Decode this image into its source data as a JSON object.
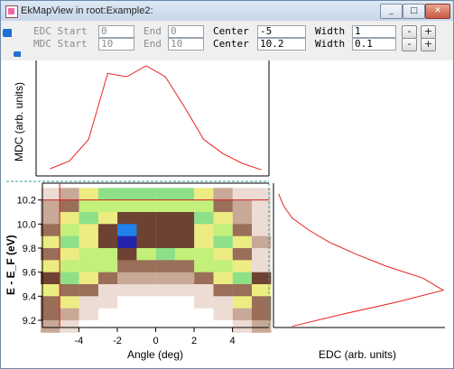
{
  "window": {
    "title": "EkMapView in root:Example2:",
    "min_label": "_",
    "max_label": "□",
    "close_label": "✕"
  },
  "controls": {
    "edc_start_label": "EDC Start",
    "edc_start_value": "0",
    "edc_end_label": "End",
    "edc_end_value": "0",
    "edc_center_label": "Center",
    "edc_center_value": "-5",
    "edc_width_label": "Width",
    "edc_width_value": "1",
    "mdc_start_label": "MDC Start",
    "mdc_start_value": "10",
    "mdc_end_label": "End",
    "mdc_end_value": "10",
    "mdc_center_label": "Center",
    "mdc_center_value": "10.2",
    "mdc_width_label": "Width",
    "mdc_width_value": "0.1",
    "minus_label": "-",
    "plus_label": "+"
  },
  "colors": {
    "curve": "#e62020",
    "cursor": "#cc2222",
    "grid_dash": "#2aa198"
  },
  "chart_data": [
    {
      "type": "line",
      "name": "MDC",
      "ylabel": "MDC (arb. units)",
      "x": [
        -5.5,
        -4.5,
        -3.5,
        -2.5,
        -1.5,
        -0.5,
        0.5,
        1.5,
        2.5,
        3.5,
        4.5,
        5.5
      ],
      "y": [
        0.05,
        0.12,
        0.32,
        0.93,
        0.9,
        1.0,
        0.9,
        0.62,
        0.32,
        0.19,
        0.1,
        0.04
      ]
    },
    {
      "type": "heatmap",
      "name": "E-k map",
      "xlabel": "Angle (deg)",
      "ylabel": "E - E_F (eV)",
      "xlim": [
        -5.9,
        5.9
      ],
      "ylim": [
        9.14,
        10.34
      ],
      "xticks": [
        -4,
        -2,
        0,
        2,
        4
      ],
      "yticks": [
        9.2,
        9.4,
        9.6,
        9.8,
        10.0,
        10.2
      ],
      "x_centers": [
        -5.5,
        -4.5,
        -3.5,
        -2.5,
        -1.5,
        -0.5,
        0.5,
        1.5,
        2.5,
        3.5,
        4.5,
        5.5
      ],
      "y_centers": [
        10.25,
        10.15,
        10.05,
        9.95,
        9.85,
        9.75,
        9.65,
        9.55,
        9.45,
        9.35,
        9.25,
        9.15
      ],
      "values": [
        [
          0.1,
          0.2,
          0.5,
          0.7,
          0.7,
          0.7,
          0.7,
          0.7,
          0.5,
          0.2,
          0.1,
          0.05
        ],
        [
          0.15,
          0.3,
          0.55,
          0.55,
          0.55,
          0.6,
          0.6,
          0.55,
          0.55,
          0.3,
          0.2,
          0.1
        ],
        [
          0.2,
          0.5,
          0.7,
          0.45,
          0.4,
          0.4,
          0.4,
          0.4,
          0.7,
          0.5,
          0.2,
          0.1
        ],
        [
          0.3,
          0.6,
          0.5,
          0.35,
          0.9,
          0.4,
          0.4,
          0.4,
          0.5,
          0.6,
          0.3,
          0.1
        ],
        [
          0.5,
          0.7,
          0.45,
          0.4,
          1.0,
          0.4,
          0.4,
          0.4,
          0.45,
          0.7,
          0.5,
          0.15
        ],
        [
          0.3,
          0.45,
          0.55,
          0.6,
          0.35,
          0.6,
          0.7,
          0.6,
          0.55,
          0.45,
          0.3,
          0.1
        ],
        [
          0.45,
          0.55,
          0.6,
          0.55,
          0.3,
          0.25,
          0.25,
          0.3,
          0.55,
          0.6,
          0.45,
          0.1
        ],
        [
          0.4,
          0.65,
          0.5,
          0.25,
          0.15,
          0.2,
          0.2,
          0.15,
          0.25,
          0.5,
          0.65,
          0.4
        ],
        [
          0.45,
          0.25,
          0.3,
          0.1,
          0.05,
          0.05,
          0.05,
          0.05,
          0.1,
          0.3,
          0.25,
          0.45
        ],
        [
          0.3,
          0.45,
          0.1,
          0.05,
          0.03,
          0.03,
          0.03,
          0.03,
          0.05,
          0.1,
          0.45,
          0.3
        ],
        [
          0.25,
          0.15,
          0.05,
          0.03,
          0.02,
          0.02,
          0.02,
          0.02,
          0.03,
          0.05,
          0.15,
          0.25
        ],
        [
          0.15,
          0.05,
          0.02,
          0.02,
          0.01,
          0.01,
          0.01,
          0.01,
          0.02,
          0.02,
          0.05,
          0.15
        ]
      ],
      "colormap": [
        "#ffffff",
        "#ecdcd4",
        "#c8a896",
        "#9a6e58",
        "#6e4232",
        "#ecec82",
        "#c2f07a",
        "#8ee088",
        "#24cc60",
        "#1e82e8",
        "#2424aa"
      ],
      "cursor_vertical_x": -5,
      "cursor_horizontal_y": 10.2
    },
    {
      "type": "line",
      "name": "EDC",
      "xlabel": "EDC (arb. units)",
      "y": [
        10.25,
        10.15,
        10.05,
        9.95,
        9.85,
        9.75,
        9.65,
        9.55,
        9.45,
        9.35,
        9.25,
        9.15
      ],
      "x": [
        0.02,
        0.05,
        0.1,
        0.2,
        0.32,
        0.48,
        0.66,
        0.88,
        1.0,
        0.72,
        0.4,
        0.1
      ]
    }
  ]
}
